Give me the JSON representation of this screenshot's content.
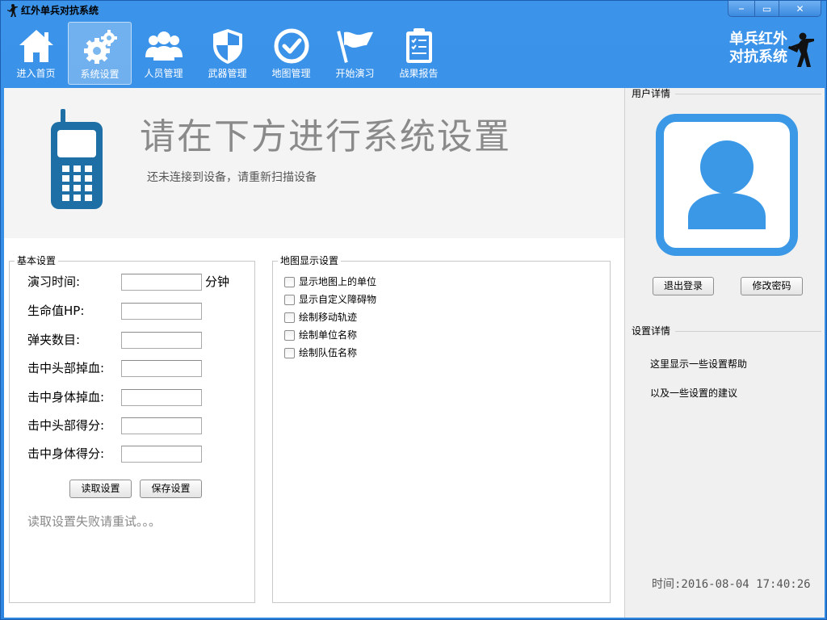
{
  "window": {
    "title": "红外单兵对抗系统",
    "controls": [
      "⎯",
      "▭",
      "✕"
    ]
  },
  "colors": {
    "toolbar_bg": "#3a8fe6",
    "icon_blue": "#3a98e6",
    "banner_title": "#8a8a8a"
  },
  "toolbar": {
    "items": [
      {
        "label": "进入首页",
        "icon": "home-icon"
      },
      {
        "label": "系统设置",
        "icon": "gear-icon",
        "active": true
      },
      {
        "label": "人员管理",
        "icon": "people-icon"
      },
      {
        "label": "武器管理",
        "icon": "shield-icon"
      },
      {
        "label": "地图管理",
        "icon": "check-circle-icon"
      },
      {
        "label": "开始演习",
        "icon": "flag-icon"
      },
      {
        "label": "战果报告",
        "icon": "clipboard-icon"
      }
    ],
    "brand_line1": "单兵红外",
    "brand_line2": "对抗系统"
  },
  "banner": {
    "title": "请在下方进行系统设置",
    "subtitle": "还未连接到设备，请重新扫描设备"
  },
  "basic": {
    "title": "基本设置",
    "fields": [
      {
        "label": "演习时间:",
        "value": "",
        "unit": "分钟"
      },
      {
        "label": "生命值HP:",
        "value": ""
      },
      {
        "label": "弹夹数目:",
        "value": ""
      },
      {
        "label": "击中头部掉血:",
        "value": ""
      },
      {
        "label": "击中身体掉血:",
        "value": ""
      },
      {
        "label": "击中头部得分:",
        "value": ""
      },
      {
        "label": "击中身体得分:",
        "value": ""
      }
    ],
    "read_button": "读取设置",
    "save_button": "保存设置",
    "status": "读取设置失败请重试。。。"
  },
  "map": {
    "title": "地图显示设置",
    "options": [
      {
        "label": "显示地图上的单位",
        "checked": false
      },
      {
        "label": "显示自定义障碍物",
        "checked": false
      },
      {
        "label": "绘制移动轨迹",
        "checked": false
      },
      {
        "label": "绘制单位名称",
        "checked": false
      },
      {
        "label": "绘制队伍名称",
        "checked": false
      }
    ]
  },
  "user": {
    "title": "用户详情",
    "logout_button": "退出登录",
    "change_password_button": "修改密码"
  },
  "settings_detail": {
    "title": "设置详情",
    "line1": "这里显示一些设置帮助",
    "line2": "以及一些设置的建议"
  },
  "clock": "时间:2016-08-04 17:40:26"
}
